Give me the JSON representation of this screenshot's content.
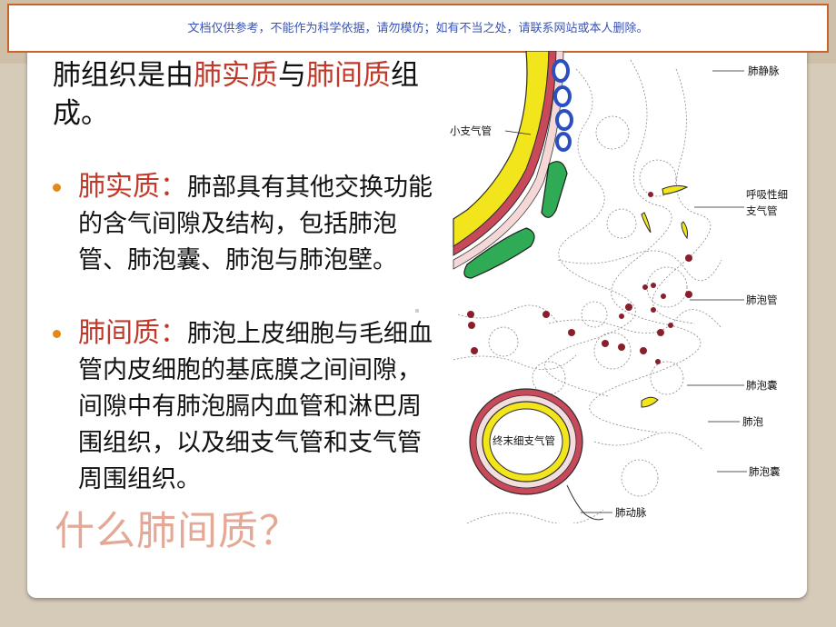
{
  "banner": {
    "notice": "文档仅供参考，不能作为科学依据，请勿模仿；如有不当之处，请联系网站或本人删除。"
  },
  "intro": {
    "p1": "肺组织是由",
    "t1": "肺实质",
    "p2": "与",
    "t2": "肺间质",
    "p3": "组成。"
  },
  "bullets": [
    {
      "term": "肺实质：",
      "text": "肺部具有其他交换功能的含气间隙及结构，包括肺泡管、肺泡囊、肺泡与肺泡壁。"
    },
    {
      "term": "肺间质：",
      "text": "肺泡上皮细胞与毛细血管内皮细胞的基底膜之间间隙，间隙中有肺泡膈内血管和淋巴周围组织，以及细支气管和支气管周围组织。"
    }
  ],
  "overlay_title": "什么肺间质？",
  "figure_labels": {
    "pulmonary_vein": "肺静脉",
    "small_bronchus": "小支气管",
    "resp_bronchiole_1": "呼吸性细",
    "resp_bronchiole_2": "支气管",
    "alveolar_duct": "肺泡管",
    "alveolar_sac_1": "肺泡囊",
    "alveolus": "肺泡",
    "alveolar_sac_2": "肺泡囊",
    "terminal_bronchiole": "终末细支气管",
    "pulmonary_artery": "肺动脉"
  },
  "colors": {
    "accent_red": "#c0392b",
    "bullet_orange": "#e08a1e",
    "banner_border": "#c8632a",
    "banner_text": "#3a55b5"
  }
}
